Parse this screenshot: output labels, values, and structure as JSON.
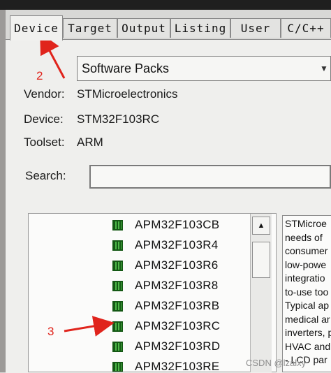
{
  "tabs": [
    "Device",
    "Target",
    "Output",
    "Listing",
    "User",
    "C/C++"
  ],
  "dropdown": {
    "value": "Software Packs"
  },
  "info": {
    "vendor_label": "Vendor:",
    "vendor_value": "STMicroelectronics",
    "device_label": "Device:",
    "device_value": "STM32F103RC",
    "toolset_label": "Toolset:",
    "toolset_value": "ARM"
  },
  "search": {
    "label": "Search:",
    "value": ""
  },
  "devices": [
    "APM32F103CB",
    "APM32F103R4",
    "APM32F103R6",
    "APM32F103R8",
    "APM32F103RB",
    "APM32F103RC",
    "APM32F103RD",
    "APM32F103RE"
  ],
  "description_lines": [
    "STMicroe",
    "needs of",
    "consumer",
    "low-powe",
    "integratio",
    "to-use too",
    "Typical ap",
    "medical ar",
    "inverters, p",
    "HVAC and",
    "- LCD par"
  ],
  "annotations": [
    "2",
    "3"
  ],
  "watermark": "CSDN @lzalxy",
  "colors": {
    "arrow": "#e0241c",
    "chip": "#2f8f2a"
  }
}
